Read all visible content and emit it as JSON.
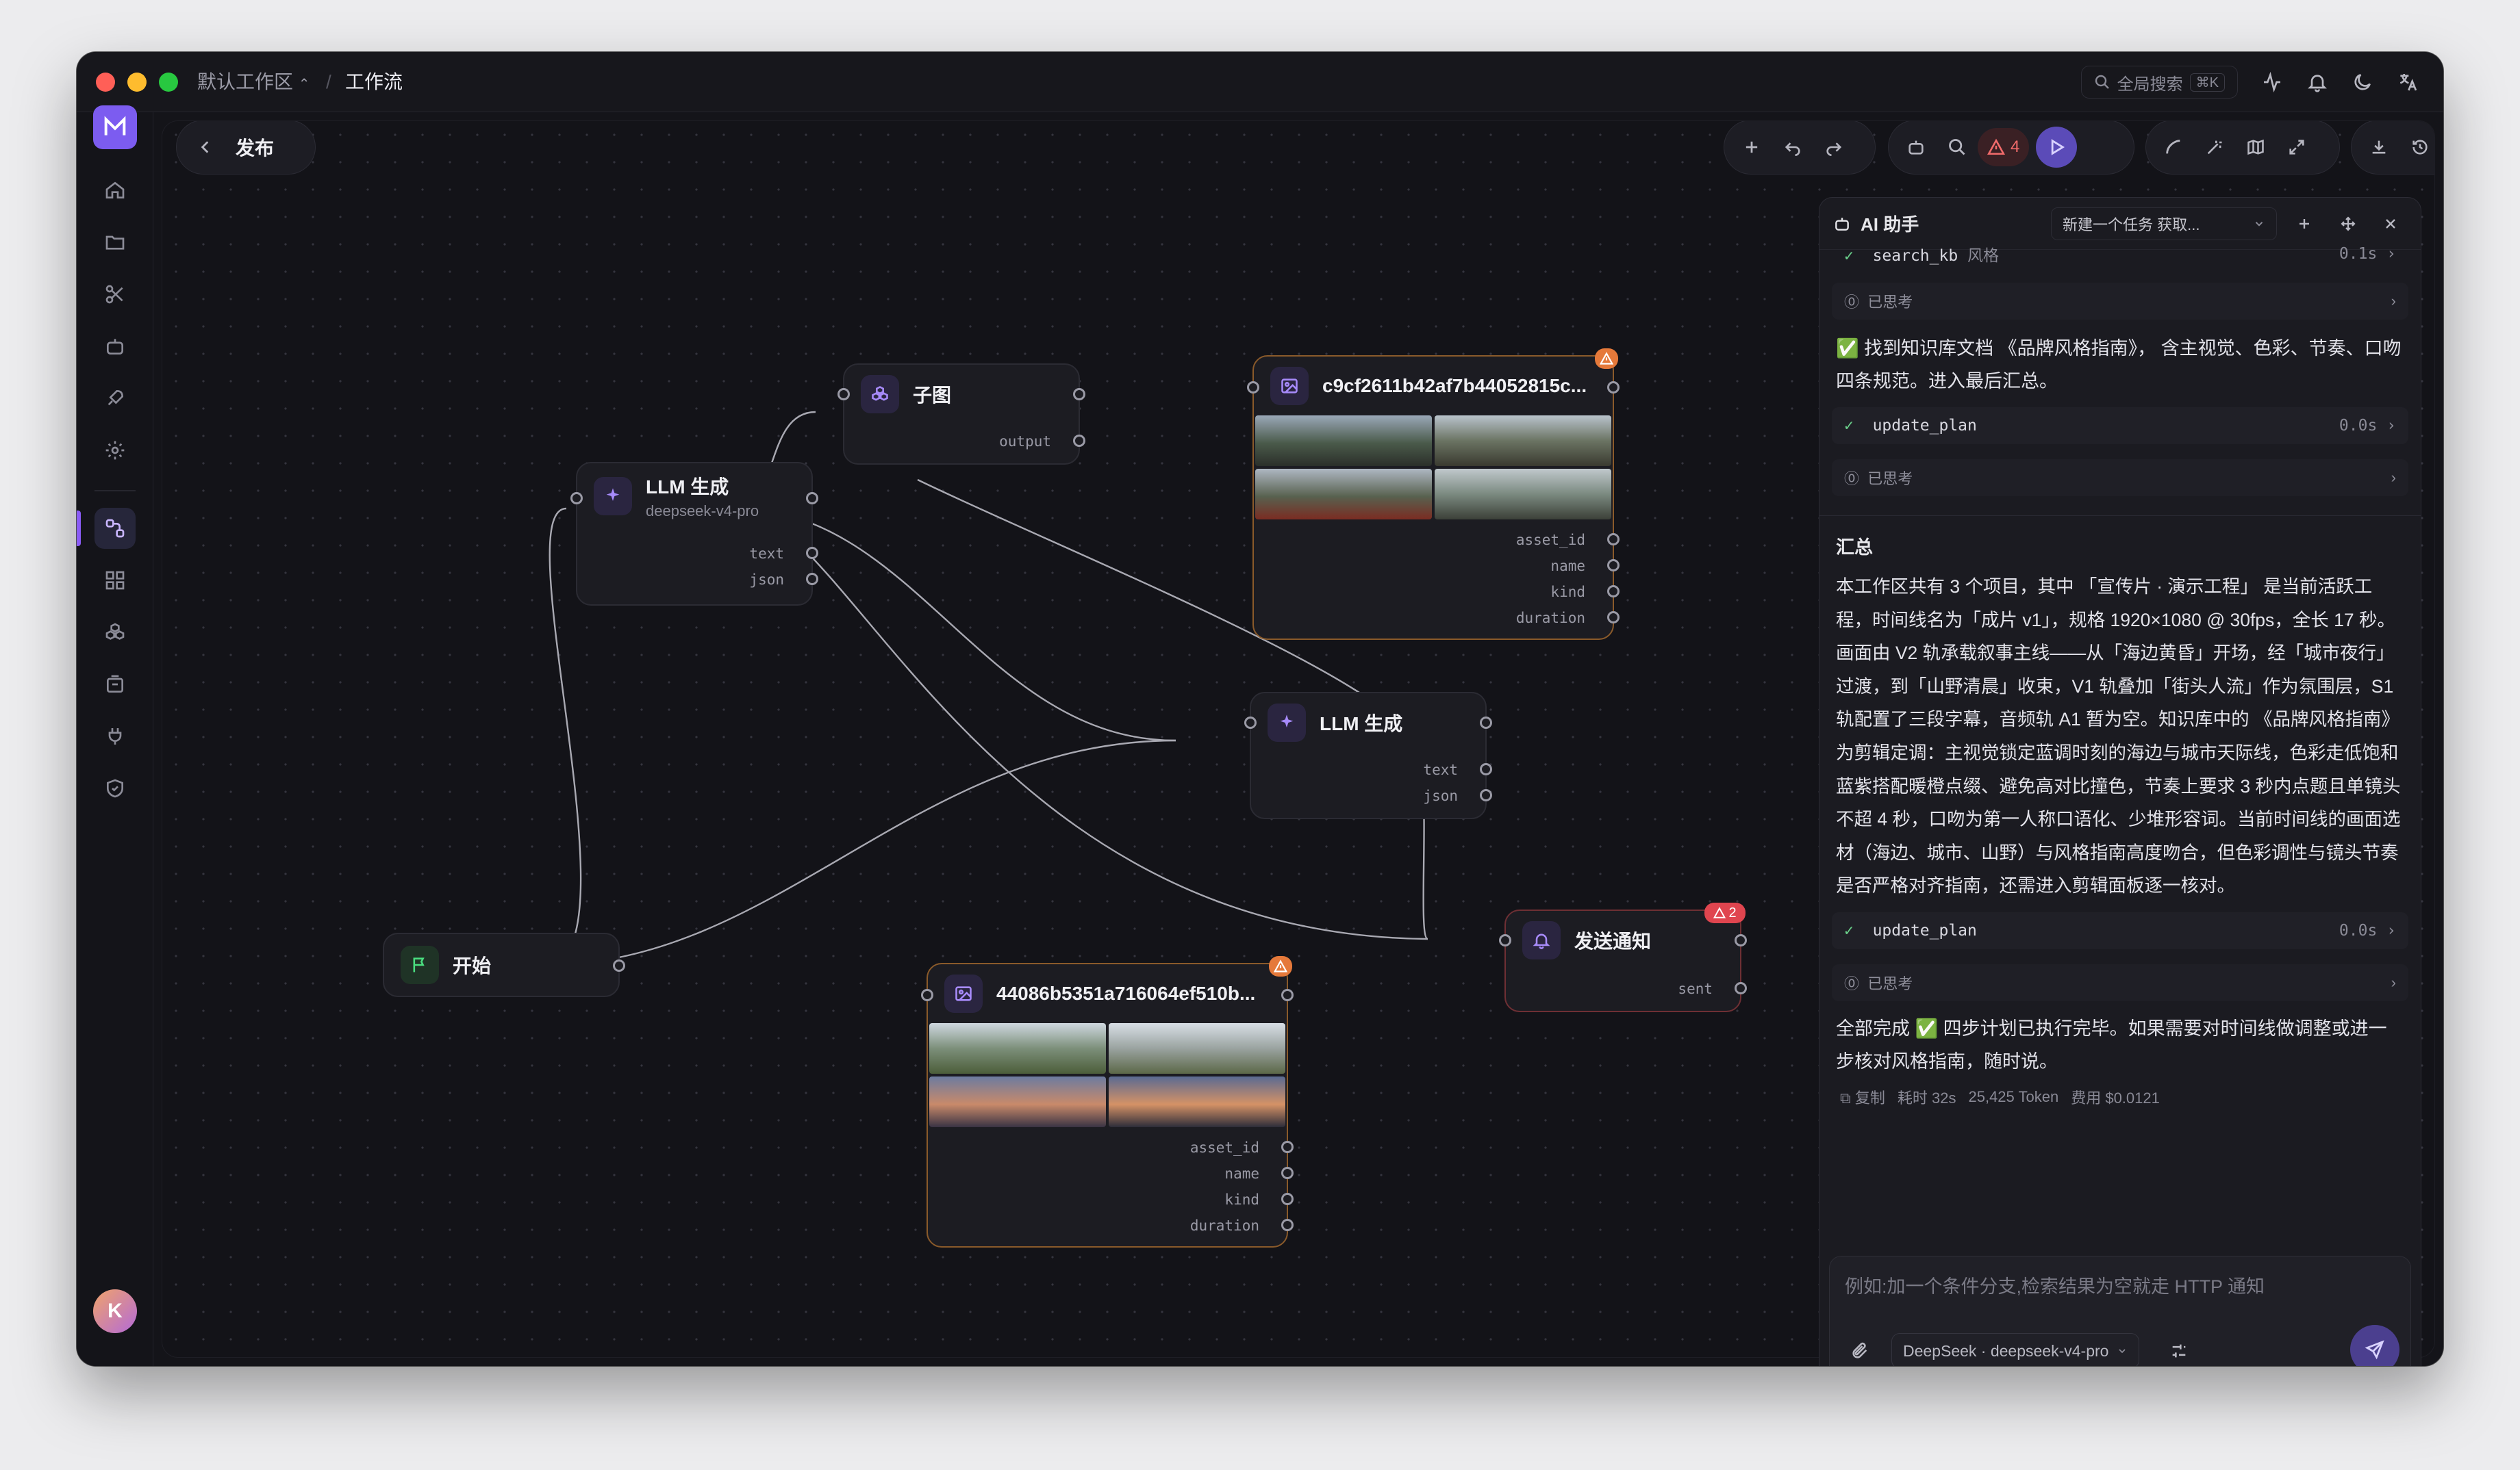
{
  "titlebar": {
    "workspace": "默认工作区",
    "separator": "/",
    "page": "工作流",
    "search_label": "全局搜索",
    "search_shortcut": "⌘K"
  },
  "toolbar": {
    "back_label": "发布",
    "warning_count": "4"
  },
  "nodes": {
    "subgraph": {
      "title": "子图",
      "port": "output"
    },
    "llm1": {
      "title": "LLM 生成",
      "subtitle": "deepseek-v4-pro",
      "ports": [
        "text",
        "json"
      ]
    },
    "llm2": {
      "title": "LLM 生成",
      "ports": [
        "text",
        "json"
      ]
    },
    "image1": {
      "title": "c9cf2611b42af7b44052815c...",
      "ports": [
        "asset_id",
        "name",
        "kind",
        "duration"
      ]
    },
    "image2": {
      "title": "44086b5351a716064ef510b...",
      "ports": [
        "asset_id",
        "name",
        "kind",
        "duration"
      ]
    },
    "start": {
      "title": "开始"
    },
    "notify": {
      "title": "发送通知",
      "port": "sent",
      "badge": "2"
    }
  },
  "assistant": {
    "title": "AI 助手",
    "task": "新建一个任务 获取...",
    "top_tool": {
      "name": "search_kb",
      "tag": "风格",
      "time": "0.1s"
    },
    "thought_label": "已思考",
    "msg1": "✅ 找到知识库文档 《品牌风格指南》， 含主视觉、色彩、节奏、口吻四条规范。进入最后汇总。",
    "tool1": {
      "name": "update_plan",
      "time": "0.0s"
    },
    "summary_heading": "汇总",
    "summary": "本工作区共有 3 个项目，其中 「宣传片 · 演示工程」 是当前活跃工程，时间线名为「成片 v1」，规格 1920×1080 @ 30fps，全长 17 秒。画面由 V2 轨承载叙事主线——从「海边黄昏」开场，经「城市夜行」过渡，到「山野清晨」收束，V1 轨叠加「街头人流」作为氛围层，S1 轨配置了三段字幕，音频轨 A1 暂为空。知识库中的 《品牌风格指南》 为剪辑定调：主视觉锁定蓝调时刻的海边与城市天际线，色彩走低饱和蓝紫搭配暖橙点缀、避免高对比撞色，节奏上要求 3 秒内点题且单镜头不超 4 秒，口吻为第一人称口语化、少堆形容词。当前时间线的画面选材（海边、城市、山野）与风格指南高度吻合，但色彩调性与镜头节奏是否严格对齐指南，还需进入剪辑面板逐一核对。",
    "tool2": {
      "name": "update_plan",
      "time": "0.0s"
    },
    "final": "全部完成 ✅ 四步计划已执行完毕。如果需要对时间线做调整或进一步核对风格指南，随时说。",
    "stats": {
      "copy": "复制",
      "time_label": "耗时",
      "time": "32s",
      "tokens": "25,425 Token",
      "cost_label": "费用",
      "cost": "$0.0121"
    },
    "input_placeholder": "例如:加一个条件分支,检索结果为空就走 HTTP 通知",
    "model": "DeepSeek · deepseek-v4-pro"
  },
  "user": {
    "avatar": "K"
  },
  "colors": {
    "accent": "#8b5cf6",
    "warning": "#e5793a",
    "canvas": "#131318"
  }
}
